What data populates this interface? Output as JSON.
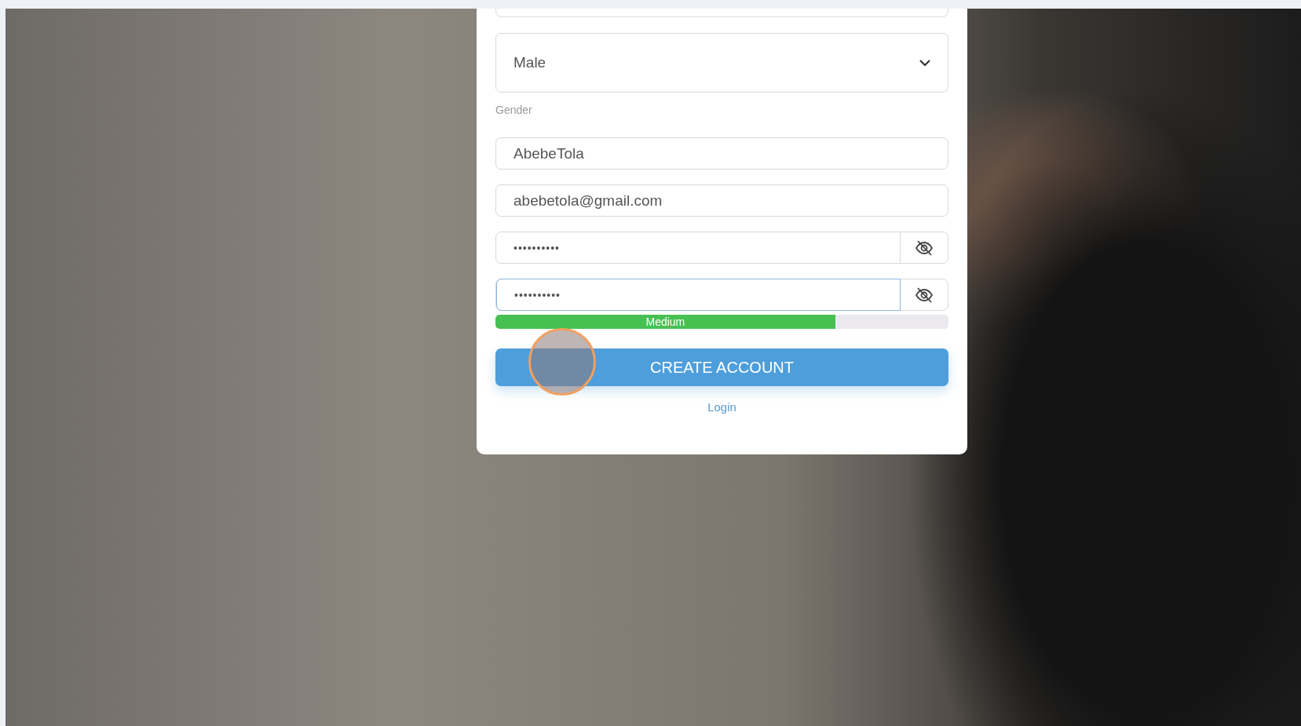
{
  "fields": [
    {
      "kind": "select",
      "value": "Male",
      "label": "Gender"
    },
    {
      "kind": "text",
      "value": "AbebeTola",
      "focused": false
    },
    {
      "kind": "text",
      "value": "abebetola@gmail.com",
      "focused": false
    },
    {
      "kind": "password",
      "value": "••••••••••",
      "focused": false
    },
    {
      "kind": "password",
      "value": "••••••••••",
      "focused": true
    }
  ],
  "strength": {
    "label": "Medium",
    "level": 0.75
  },
  "create_button": "CREATE ACCOUNT",
  "login_link": "Login"
}
